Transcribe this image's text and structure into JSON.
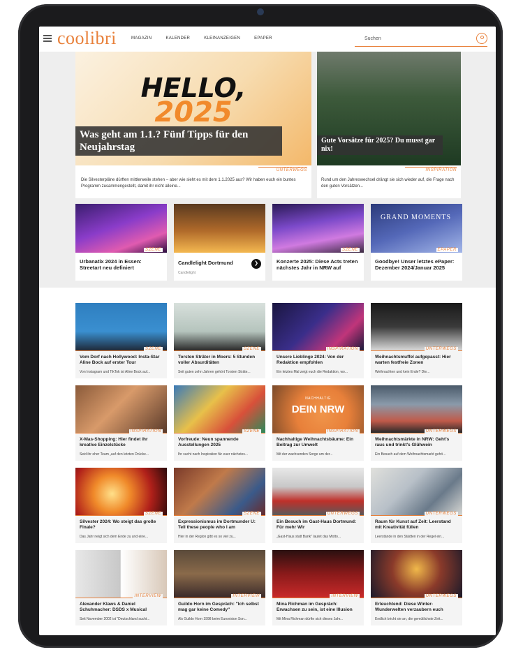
{
  "site": {
    "logo": "coolibri",
    "search_placeholder": "Suchen"
  },
  "nav": [
    "MAGAZIN",
    "KALENDER",
    "KLEINANZEIGEN",
    "EPAPER"
  ],
  "featured": {
    "big": {
      "hello_line1": "HELLO,",
      "hello_line2": "2025",
      "title": "Was geht am 1.1.? Fünf Tipps für den Neujahrstag",
      "tag": "UNTERWEGS",
      "excerpt": "Die Silvesterpläne dürften mittlerweile stehen – aber wie sieht es mit dem 1.1.2025 aus? Wir haben euch ein buntes Programm zusammengestellt, damit ihr nicht alleine..."
    },
    "small": {
      "title": "Gute Vorsätze für 2025? Du musst gar nix!",
      "tag": "INSPIRATION",
      "excerpt": "Rund um den Jahreswechsel drängt sie sich wieder auf, die Frage nach den guten Vorsätzen..."
    }
  },
  "mid": [
    {
      "title": "Urbanatix 2024 in Essen: Streetart neu definiert",
      "tag": "SZENE"
    },
    {
      "title": "Candlelight Dortmund",
      "tag": "",
      "sub": "Candlelight"
    },
    {
      "title": "Konzerte 2025: Diese Acts treten nächstes Jahr in NRW auf",
      "tag": "SZENE"
    },
    {
      "title": "Goodbye! Unser letztes ePaper: Dezember 2024/Januar 2025",
      "tag": "EPAPER",
      "img_text": "GRAND MOMENTS"
    }
  ],
  "grid": [
    {
      "title": "Vom Dorf nach Hollywood: Insta-Star Aline Bock auf erster Tour",
      "tag": "SZENE",
      "snippet": "Von Instagram und TikTok ist Aline Bock auf..."
    },
    {
      "title": "Torsten Sträter in Moers: 5 Stunden voller Absurditäten",
      "tag": "SZENE",
      "snippet": "Seit guten zehn Jahren gehört Torsten Sträte..."
    },
    {
      "title": "Unsere Lieblinge 2024: Von der Redaktion empfohlen",
      "tag": "INSPIRATION",
      "snippet": "Ein letztes Mal zeigt euch die Redaktion, wo..."
    },
    {
      "title": "Weihnachtsmuffel aufgepasst: Hier warten festfreie Zonen",
      "tag": "UNTERWEGS",
      "snippet": "Weihnachten und kein Ende? Die..."
    },
    {
      "title": "X-Mas-Shopping: Hier findet ihr kreative Einzelstücke",
      "tag": "INSPIRATION",
      "snippet": "Seid ihr eher Team „auf den letzten Drücke..."
    },
    {
      "title": "Vorfreude: Neun spannende Ausstellungen 2025",
      "tag": "SZENE",
      "snippet": "Ihr sucht nach Inspiration für euer nächstes..."
    },
    {
      "title": "Nachhaltige Weihnachtsbäume: Ein Beitrag zur Umwelt",
      "tag": "INSPIRATION",
      "snippet": "Mit der wachsenden Sorge um der...",
      "img_text1": "NACHHALTIG",
      "img_text2": "DEIN NRW"
    },
    {
      "title": "Weihnachtsmärkte in NRW: Geht's raus und trinkt's Glühwein",
      "tag": "UNTERWEGS",
      "snippet": "Ein Besuch auf dem Weihnachtsmarkt gehö..."
    },
    {
      "title": "Silvester 2024: Wo steigt das große Finale?",
      "tag": "SZENE",
      "snippet": "Das Jahr neigt sich dem Ende zu und eine..."
    },
    {
      "title": "Expressionismus im Dortmunder U: Tell these people who I am",
      "tag": "SZENE",
      "snippet": "Hier in der Region gibt es so viel zu..."
    },
    {
      "title": "Ein Besuch im Gast-Haus Dortmund: Für mehr Wir",
      "tag": "UNTERWEGS",
      "snippet": "„Gast-Haus statt Bank\" lautet das Motto..."
    },
    {
      "title": "Raum für Kunst auf Zeit: Leerstand mit Kreativität füllen",
      "tag": "UNTERWEGS",
      "snippet": "Leerstände in den Städten in der Regel ein..."
    },
    {
      "title": "Alexander Klaws & Daniel Schuhmacher: DSDS x Musical",
      "tag": "INTERVIEW",
      "snippet": "Seit November 2002 ist \"Deutschland sucht..."
    },
    {
      "title": "Guildo Horn im Gespräch: \"Ich selbst mag gar keine Comedy\"",
      "tag": "INTERVIEW",
      "snippet": "Als Guildo Horn 1998 beim Eurovision Son..."
    },
    {
      "title": "Mina Richman im Gespräch: Erwachsen zu sein, ist eine Illusion",
      "tag": "INTERVIEW",
      "snippet": "Mit Mina Richman dürfte sich dieses Jahr..."
    },
    {
      "title": "Erleuchtend: Diese Winter-Wunderwelten verzaubern euch",
      "tag": "UNTERWEGS",
      "snippet": "Endlich bricht sie an, die gemütlichste Zeit..."
    }
  ],
  "colors": {
    "accent": "#e8803a",
    "overlay": "#3a3a3a",
    "section_bg": "#eeeeee"
  }
}
